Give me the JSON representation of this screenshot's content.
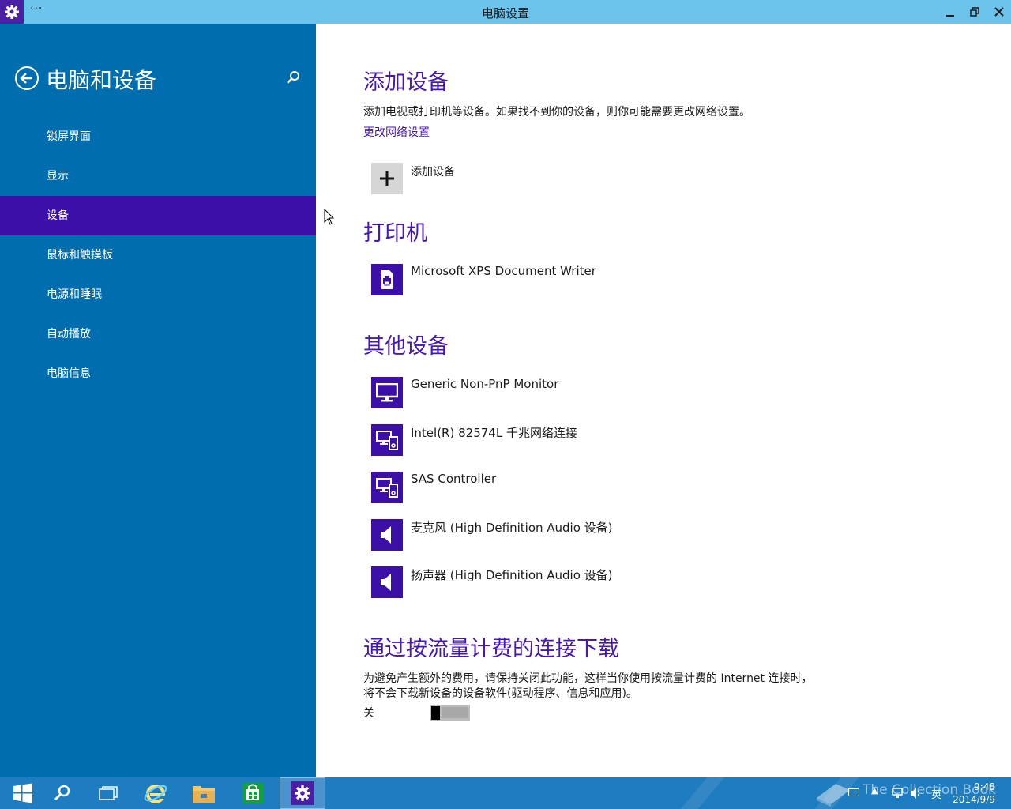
{
  "window": {
    "title": "电脑设置",
    "menu_glyph": "···",
    "minimize_glyph": "—",
    "restore_glyph": "❐",
    "close_glyph": "✕"
  },
  "sidebar": {
    "title": "电脑和设备",
    "items": [
      {
        "label": "锁屏界面"
      },
      {
        "label": "显示"
      },
      {
        "label": "设备",
        "selected": true
      },
      {
        "label": "鼠标和触摸板"
      },
      {
        "label": "电源和睡眠"
      },
      {
        "label": "自动播放"
      },
      {
        "label": "电脑信息"
      }
    ]
  },
  "add_devices": {
    "heading": "添加设备",
    "description": "添加电视或打印机等设备。如果找不到你的设备，则你可能需要更改网络设置。",
    "link": "更改网络设置",
    "button_label": "添加设备"
  },
  "printers": {
    "heading": "打印机",
    "items": [
      {
        "label": "Microsoft XPS Document Writer",
        "icon": "printer-icon"
      }
    ]
  },
  "other_devices": {
    "heading": "其他设备",
    "items": [
      {
        "label": "Generic Non-PnP Monitor",
        "icon": "monitor-icon"
      },
      {
        "label": "Intel(R) 82574L 千兆网络连接",
        "icon": "devices-icon"
      },
      {
        "label": "SAS Controller",
        "icon": "devices-icon"
      },
      {
        "label": "麦克风 (High Definition Audio 设备)",
        "icon": "speaker-icon"
      },
      {
        "label": "扬声器 (High Definition Audio 设备)",
        "icon": "speaker-icon"
      }
    ]
  },
  "metered": {
    "heading": "通过按流量计费的连接下载",
    "line1": "为避免产生额外的费用，请保持关闭此功能，这样当你使用按流量计费的 Internet 连接时，",
    "line2": "将不会下载新设备的设备软件(驱动程序、信息和应用)。",
    "toggle_label": "关",
    "toggle_on": false
  },
  "taskbar": {
    "time": "9:48",
    "date": "2014/9/9",
    "ime": "英",
    "watermark": "The Collection Book"
  },
  "colors": {
    "sidebar_bg": "#006dae",
    "selected_bg": "#3b0fa8",
    "accent": "#4617b4",
    "titlebar": "#6cc3ec",
    "taskbar": "#1e7dc0"
  }
}
